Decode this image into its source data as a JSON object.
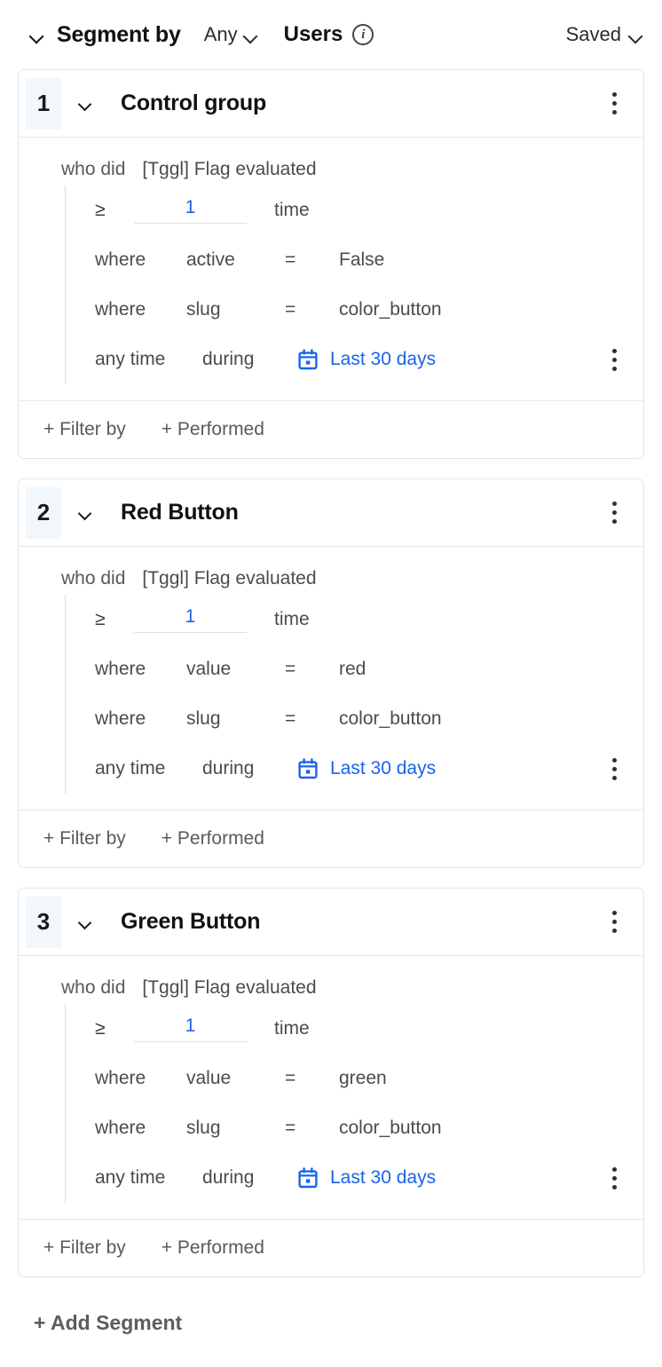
{
  "header": {
    "collapse_icon": "chevron-down-icon",
    "title": "Segment by",
    "match_mode": "Any",
    "entity": "Users",
    "info_icon": "info-icon",
    "saved_label": "Saved"
  },
  "segments": [
    {
      "number": "1",
      "name": "Control group",
      "who_did_label": "who did",
      "event_name": "[Tggl] Flag evaluated",
      "count": {
        "operator": "≥",
        "value": "1",
        "unit": "time"
      },
      "filters": [
        {
          "prefix": "where",
          "property": "active",
          "operator": "=",
          "value": "False"
        },
        {
          "prefix": "where",
          "property": "slug",
          "operator": "=",
          "value": "color_button"
        }
      ],
      "time": {
        "scope": "any time",
        "preposition": "during",
        "icon": "calendar-icon",
        "range": "Last 30 days"
      },
      "footer": {
        "filter_by": "+ Filter by",
        "performed": "+ Performed"
      }
    },
    {
      "number": "2",
      "name": "Red Button",
      "who_did_label": "who did",
      "event_name": "[Tggl] Flag evaluated",
      "count": {
        "operator": "≥",
        "value": "1",
        "unit": "time"
      },
      "filters": [
        {
          "prefix": "where",
          "property": "value",
          "operator": "=",
          "value": "red"
        },
        {
          "prefix": "where",
          "property": "slug",
          "operator": "=",
          "value": "color_button"
        }
      ],
      "time": {
        "scope": "any time",
        "preposition": "during",
        "icon": "calendar-icon",
        "range": "Last 30 days"
      },
      "footer": {
        "filter_by": "+ Filter by",
        "performed": "+ Performed"
      }
    },
    {
      "number": "3",
      "name": "Green Button",
      "who_did_label": "who did",
      "event_name": "[Tggl] Flag evaluated",
      "count": {
        "operator": "≥",
        "value": "1",
        "unit": "time"
      },
      "filters": [
        {
          "prefix": "where",
          "property": "value",
          "operator": "=",
          "value": "green"
        },
        {
          "prefix": "where",
          "property": "slug",
          "operator": "=",
          "value": "color_button"
        }
      ],
      "time": {
        "scope": "any time",
        "preposition": "during",
        "icon": "calendar-icon",
        "range": "Last 30 days"
      },
      "footer": {
        "filter_by": "+ Filter by",
        "performed": "+ Performed"
      }
    }
  ],
  "add_segment_label": "+ Add Segment",
  "colors": {
    "accent_blue": "#1a63e8",
    "badge_bg": "#f1f7fb",
    "border": "#e3e5e8",
    "text_primary": "#111111",
    "text_muted": "#4b4b50"
  }
}
